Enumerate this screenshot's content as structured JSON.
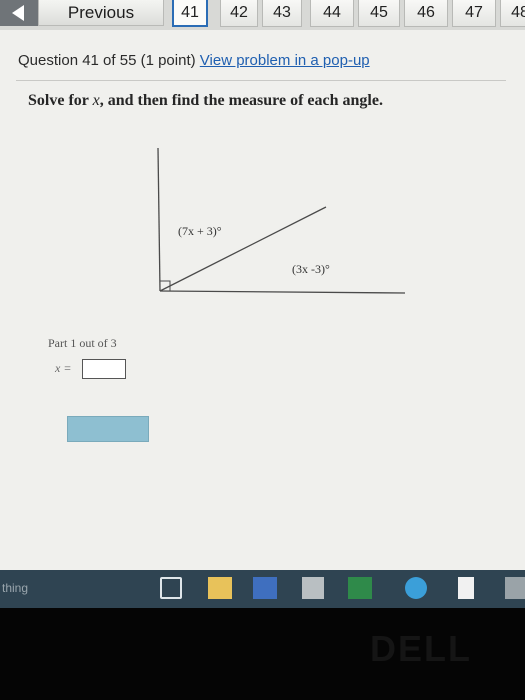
{
  "nav": {
    "previous_label": "Previous",
    "question_tabs": [
      "41",
      "42",
      "43",
      "44",
      "45",
      "46",
      "47",
      "48"
    ],
    "current_tab": "41"
  },
  "question": {
    "header": "Question 41 of 55 (1 point)",
    "popup_link": "View problem in a pop-up",
    "instruction_prefix": "Solve for ",
    "instruction_var": "x",
    "instruction_suffix": ", and then find the measure of each angle."
  },
  "figure": {
    "angle_top_label": "(7x + 3)°",
    "angle_bottom_label": "(3x -3)°"
  },
  "answer": {
    "part_label": "Part 1 out of 3",
    "variable_label": "x =",
    "input_value": ""
  },
  "taskbar": {
    "search_text": "thing",
    "color": "#2f4452"
  },
  "device": {
    "logo": "DELL"
  }
}
